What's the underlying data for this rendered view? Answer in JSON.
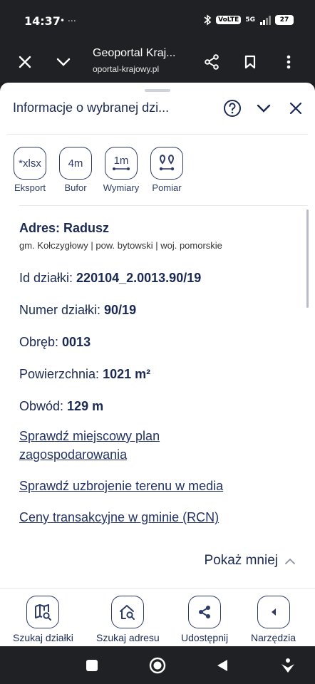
{
  "status_bar": {
    "time": "14:37",
    "left_icons": "• ⋯",
    "network": "5G",
    "volte": "VoLTE",
    "battery": "27"
  },
  "browser": {
    "title": "Geoportal Kraj...",
    "url": "oportal-krajowy.pl"
  },
  "sheet": {
    "title": "Informacje o wybranej dzi...",
    "tools": [
      {
        "box": "*xlsx",
        "label": "Eksport"
      },
      {
        "box": "4m",
        "label": "Bufor"
      },
      {
        "box": "1m",
        "label": "Wymiary"
      },
      {
        "box": "",
        "label": "Pomiar"
      }
    ],
    "address": {
      "title": "Adres: Radusz",
      "sub": "gm. Kołczygłowy | pow. bytowski | woj. pomorskie"
    },
    "rows": [
      {
        "label": "Id działki: ",
        "value": "220104_2.0013.90/19"
      },
      {
        "label": "Numer działki: ",
        "value": "90/19"
      },
      {
        "label": "Obręb: ",
        "value": "0013"
      },
      {
        "label": "Powierzchnia: ",
        "value": "1021 m²"
      },
      {
        "label": "Obwód: ",
        "value": "129 m"
      }
    ],
    "links": [
      "Sprawdź miejscowy plan zagospodarowania",
      "Sprawdź uzbrojenie terenu w media",
      "Ceny transakcyjne w gminie (RCN)"
    ],
    "show_less": "Pokaż mniej"
  },
  "bottom_nav": [
    {
      "label": "Szukaj działki"
    },
    {
      "label": "Szukaj adresu"
    },
    {
      "label": "Udostępnij"
    },
    {
      "label": "Narzędzia"
    }
  ],
  "colors": {
    "primary": "#1b2a52",
    "outline": "#2f3c68",
    "dark_bar": "#202124"
  }
}
